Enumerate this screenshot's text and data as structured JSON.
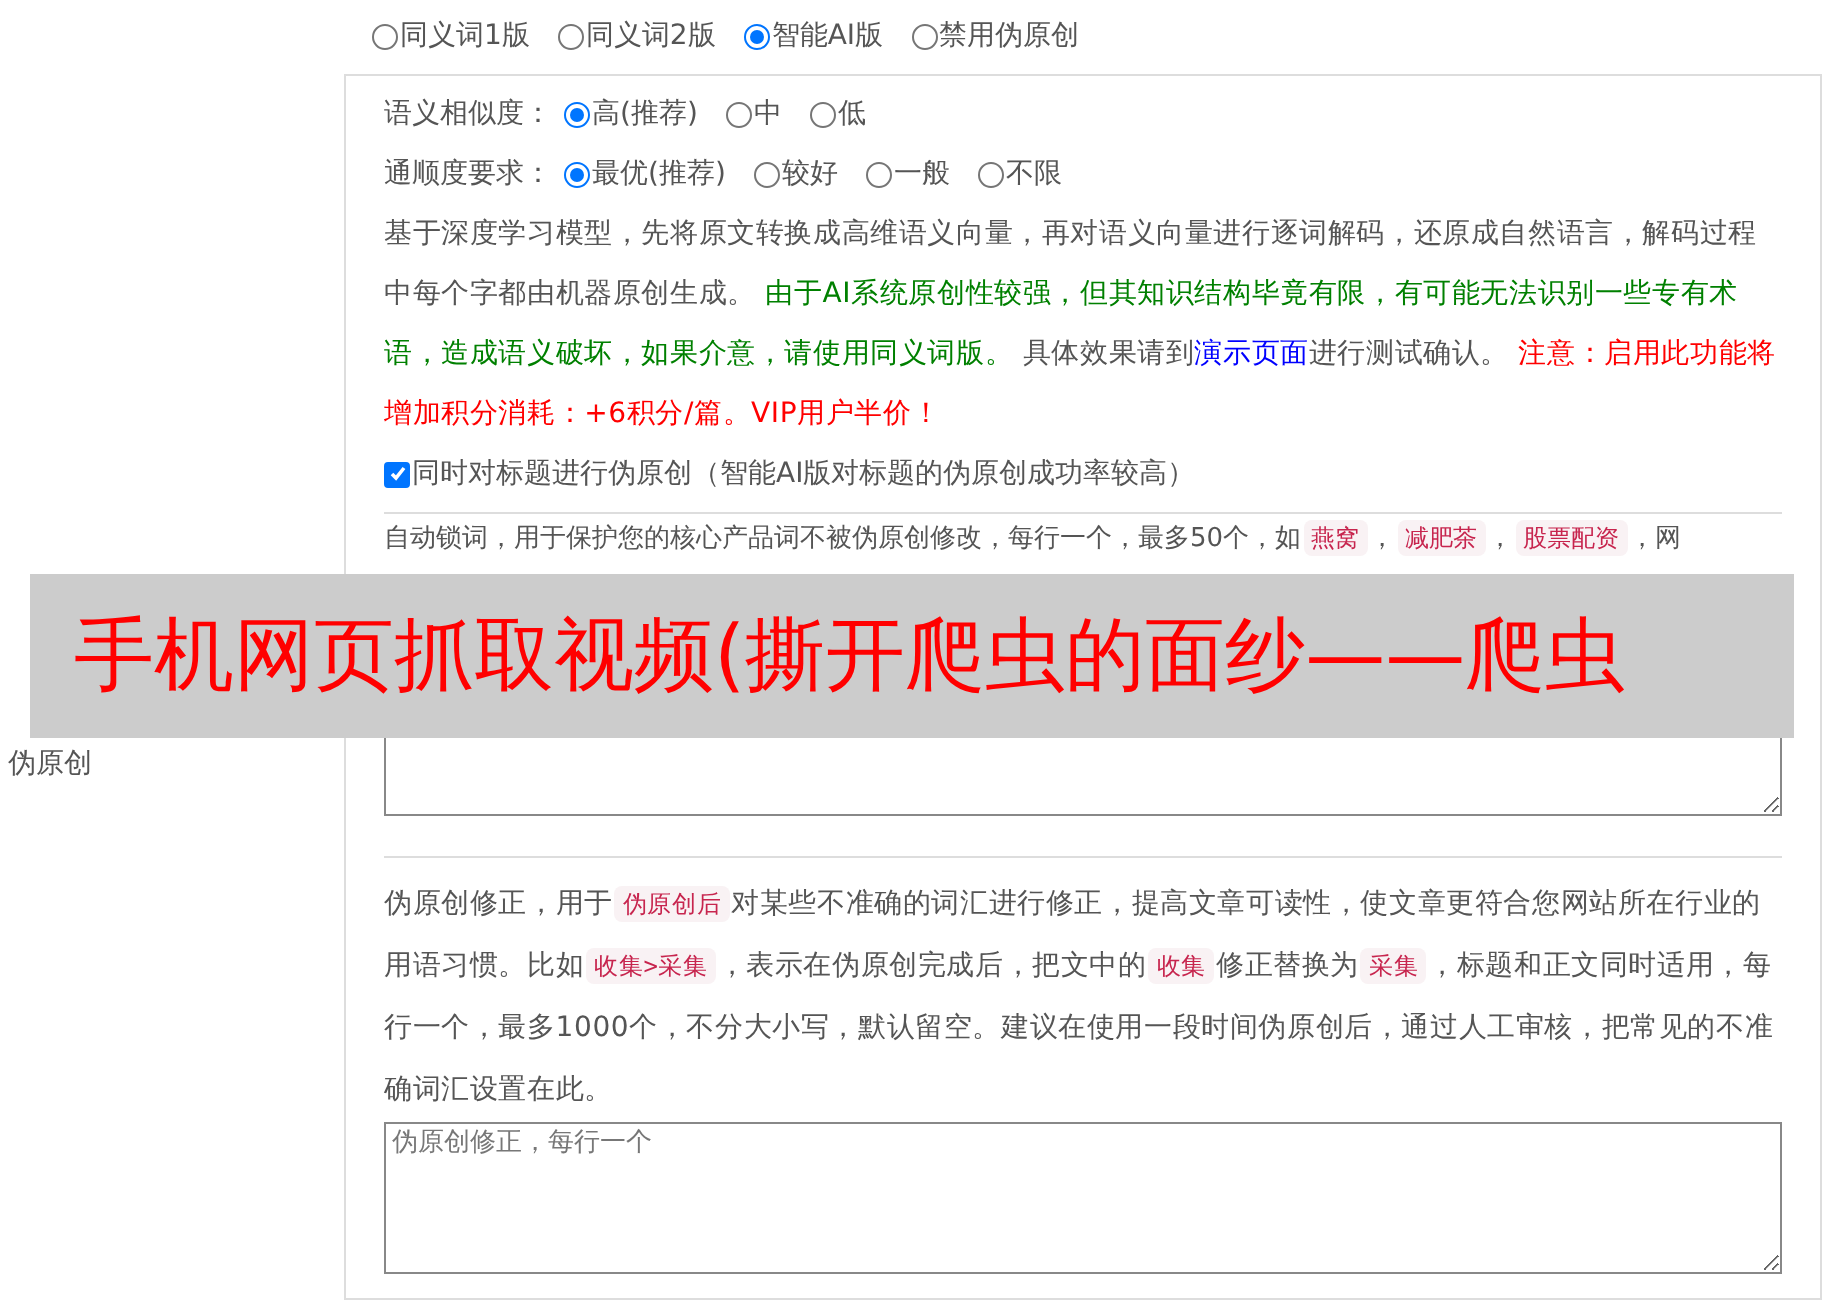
{
  "versions": [
    {
      "label": "同义词1版",
      "selected": false
    },
    {
      "label": "同义词2版",
      "selected": false
    },
    {
      "label": "智能AI版",
      "selected": true
    },
    {
      "label": "禁用伪原创",
      "selected": false
    }
  ],
  "side_label": "伪原创",
  "similarity": {
    "label": "语义相似度：",
    "options": [
      {
        "label": "高(推荐)",
        "selected": true
      },
      {
        "label": "中",
        "selected": false
      },
      {
        "label": "低",
        "selected": false
      }
    ]
  },
  "fluency": {
    "label": "通顺度要求：",
    "options": [
      {
        "label": "最优(推荐)",
        "selected": true
      },
      {
        "label": "较好",
        "selected": false
      },
      {
        "label": "一般",
        "selected": false
      },
      {
        "label": "不限",
        "selected": false
      }
    ]
  },
  "description": [
    {
      "kind": "text",
      "text": "基于深度学习模型，先将原文转换成高维语义向量，再对语义向量进行逐词解码，还原成自然语言，解码过程中每个字都由机器原创生成。 "
    },
    {
      "kind": "green",
      "text": "由于AI系统原创性较强，但其知识结构毕竟有限，有可能无法识别一些专有术语，造成语义破坏，如果介意，请使用同义词版。"
    },
    {
      "kind": "text",
      "text": " 具体效果请到"
    },
    {
      "kind": "link",
      "text": "演示页面"
    },
    {
      "kind": "text",
      "text": "进行测试确认。 "
    },
    {
      "kind": "red",
      "text": "注意：启用此功能将增加积分消耗：+6积分/篇。VIP用户半价！"
    }
  ],
  "title_option": {
    "label": "同时对标题进行伪原创（智能AI版对标题的伪原创成功率较高）",
    "checked": true
  },
  "lock_words": [
    {
      "kind": "text",
      "text": "自动锁词，用于保护您的核心产品词不被伪原创修改，每行一个，最多50个，如"
    },
    {
      "kind": "code",
      "text": "燕窝"
    },
    {
      "kind": "text",
      "text": "，"
    },
    {
      "kind": "code",
      "text": "减肥茶"
    },
    {
      "kind": "text",
      "text": "，"
    },
    {
      "kind": "code",
      "text": "股票配资"
    },
    {
      "kind": "text",
      "text": "，网"
    }
  ],
  "correction": {
    "segments": [
      {
        "kind": "text",
        "text": "伪原创修正，用于"
      },
      {
        "kind": "code",
        "text": "伪原创后"
      },
      {
        "kind": "text",
        "text": "对某些不准确的词汇进行修正，提高文章可读性，使文章更符合您网站所在行业的用语习惯。比如"
      },
      {
        "kind": "code",
        "text": "收集>采集"
      },
      {
        "kind": "text",
        "text": "，表示在伪原创完成后，把文中的"
      },
      {
        "kind": "code",
        "text": "收集"
      },
      {
        "kind": "text",
        "text": "修正替换为"
      },
      {
        "kind": "code",
        "text": "采集"
      },
      {
        "kind": "text",
        "text": "，标题和正文同时适用，每行一个，最多1000个，不分大小写，默认留空。建议在使用一段时间伪原创后，通过人工审核，把常见的不准确词汇设置在此。"
      }
    ],
    "placeholder": "伪原创修正，每行一个"
  },
  "banner": {
    "text": "手机网页抓取视频(撕开爬虫的面纱——爬虫"
  }
}
